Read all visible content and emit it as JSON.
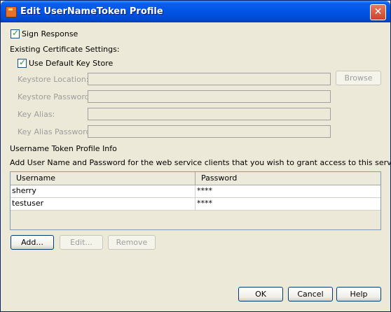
{
  "window": {
    "title": "Edit UserNameToken Profile",
    "close_symbol": "✕"
  },
  "sign_response": {
    "label": "Sign Response",
    "checked": true
  },
  "certificate": {
    "heading": "Existing Certificate Settings:",
    "use_default": {
      "label": "Use Default Key Store",
      "checked": true
    },
    "fields": [
      {
        "label": "Keystore Location:",
        "value": ""
      },
      {
        "label": "Keystore Password:",
        "value": ""
      },
      {
        "label": "Key Alias:",
        "value": ""
      },
      {
        "label": "Key Alias Password:",
        "value": ""
      }
    ],
    "browse_label": "Browse"
  },
  "profile": {
    "heading": "Username Token Profile Info",
    "description": "Add User Name and Password for the web service clients that you wish to grant access to this service.",
    "columns": [
      "Username",
      "Password"
    ],
    "rows": [
      {
        "username": "sherry",
        "password": "****"
      },
      {
        "username": "testuser",
        "password": "****"
      }
    ],
    "add_label": "Add...",
    "edit_label": "Edit...",
    "remove_label": "Remove"
  },
  "footer": {
    "ok_label": "OK",
    "cancel_label": "Cancel",
    "help_label": "Help"
  },
  "colors": {
    "title_bar": "#0055e5",
    "dialog_bg": "#ece9d8",
    "close_button": "#c8452b",
    "check_mark": "#21a121"
  },
  "icons": {
    "app": "app-icon",
    "close": "close-icon",
    "check": "check-icon"
  }
}
